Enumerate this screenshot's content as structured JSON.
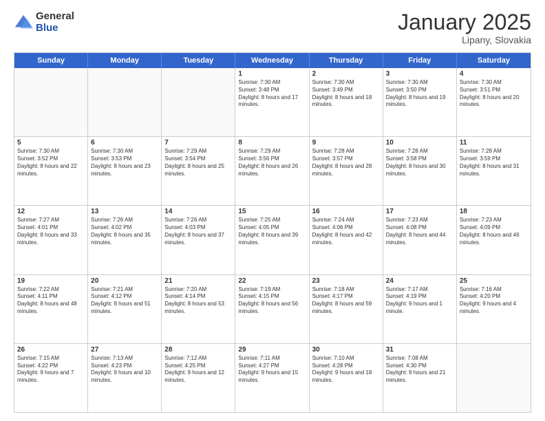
{
  "logo": {
    "general": "General",
    "blue": "Blue"
  },
  "title": "January 2025",
  "subtitle": "Lipany, Slovakia",
  "weekdays": [
    "Sunday",
    "Monday",
    "Tuesday",
    "Wednesday",
    "Thursday",
    "Friday",
    "Saturday"
  ],
  "weeks": [
    [
      {
        "day": "",
        "sunrise": "",
        "sunset": "",
        "daylight": ""
      },
      {
        "day": "",
        "sunrise": "",
        "sunset": "",
        "daylight": ""
      },
      {
        "day": "",
        "sunrise": "",
        "sunset": "",
        "daylight": ""
      },
      {
        "day": "1",
        "sunrise": "Sunrise: 7:30 AM",
        "sunset": "Sunset: 3:48 PM",
        "daylight": "Daylight: 8 hours and 17 minutes."
      },
      {
        "day": "2",
        "sunrise": "Sunrise: 7:30 AM",
        "sunset": "Sunset: 3:49 PM",
        "daylight": "Daylight: 8 hours and 18 minutes."
      },
      {
        "day": "3",
        "sunrise": "Sunrise: 7:30 AM",
        "sunset": "Sunset: 3:50 PM",
        "daylight": "Daylight: 8 hours and 19 minutes."
      },
      {
        "day": "4",
        "sunrise": "Sunrise: 7:30 AM",
        "sunset": "Sunset: 3:51 PM",
        "daylight": "Daylight: 8 hours and 20 minutes."
      }
    ],
    [
      {
        "day": "5",
        "sunrise": "Sunrise: 7:30 AM",
        "sunset": "Sunset: 3:52 PM",
        "daylight": "Daylight: 8 hours and 22 minutes."
      },
      {
        "day": "6",
        "sunrise": "Sunrise: 7:30 AM",
        "sunset": "Sunset: 3:53 PM",
        "daylight": "Daylight: 8 hours and 23 minutes."
      },
      {
        "day": "7",
        "sunrise": "Sunrise: 7:29 AM",
        "sunset": "Sunset: 3:54 PM",
        "daylight": "Daylight: 8 hours and 25 minutes."
      },
      {
        "day": "8",
        "sunrise": "Sunrise: 7:29 AM",
        "sunset": "Sunset: 3:56 PM",
        "daylight": "Daylight: 8 hours and 26 minutes."
      },
      {
        "day": "9",
        "sunrise": "Sunrise: 7:28 AM",
        "sunset": "Sunset: 3:57 PM",
        "daylight": "Daylight: 8 hours and 28 minutes."
      },
      {
        "day": "10",
        "sunrise": "Sunrise: 7:28 AM",
        "sunset": "Sunset: 3:58 PM",
        "daylight": "Daylight: 8 hours and 30 minutes."
      },
      {
        "day": "11",
        "sunrise": "Sunrise: 7:28 AM",
        "sunset": "Sunset: 3:59 PM",
        "daylight": "Daylight: 8 hours and 31 minutes."
      }
    ],
    [
      {
        "day": "12",
        "sunrise": "Sunrise: 7:27 AM",
        "sunset": "Sunset: 4:01 PM",
        "daylight": "Daylight: 8 hours and 33 minutes."
      },
      {
        "day": "13",
        "sunrise": "Sunrise: 7:26 AM",
        "sunset": "Sunset: 4:02 PM",
        "daylight": "Daylight: 8 hours and 35 minutes."
      },
      {
        "day": "14",
        "sunrise": "Sunrise: 7:26 AM",
        "sunset": "Sunset: 4:03 PM",
        "daylight": "Daylight: 8 hours and 37 minutes."
      },
      {
        "day": "15",
        "sunrise": "Sunrise: 7:25 AM",
        "sunset": "Sunset: 4:05 PM",
        "daylight": "Daylight: 8 hours and 39 minutes."
      },
      {
        "day": "16",
        "sunrise": "Sunrise: 7:24 AM",
        "sunset": "Sunset: 4:06 PM",
        "daylight": "Daylight: 8 hours and 42 minutes."
      },
      {
        "day": "17",
        "sunrise": "Sunrise: 7:23 AM",
        "sunset": "Sunset: 4:08 PM",
        "daylight": "Daylight: 8 hours and 44 minutes."
      },
      {
        "day": "18",
        "sunrise": "Sunrise: 7:23 AM",
        "sunset": "Sunset: 4:09 PM",
        "daylight": "Daylight: 8 hours and 46 minutes."
      }
    ],
    [
      {
        "day": "19",
        "sunrise": "Sunrise: 7:22 AM",
        "sunset": "Sunset: 4:11 PM",
        "daylight": "Daylight: 8 hours and 48 minutes."
      },
      {
        "day": "20",
        "sunrise": "Sunrise: 7:21 AM",
        "sunset": "Sunset: 4:12 PM",
        "daylight": "Daylight: 8 hours and 51 minutes."
      },
      {
        "day": "21",
        "sunrise": "Sunrise: 7:20 AM",
        "sunset": "Sunset: 4:14 PM",
        "daylight": "Daylight: 8 hours and 53 minutes."
      },
      {
        "day": "22",
        "sunrise": "Sunrise: 7:19 AM",
        "sunset": "Sunset: 4:15 PM",
        "daylight": "Daylight: 8 hours and 56 minutes."
      },
      {
        "day": "23",
        "sunrise": "Sunrise: 7:18 AM",
        "sunset": "Sunset: 4:17 PM",
        "daylight": "Daylight: 8 hours and 59 minutes."
      },
      {
        "day": "24",
        "sunrise": "Sunrise: 7:17 AM",
        "sunset": "Sunset: 4:19 PM",
        "daylight": "Daylight: 9 hours and 1 minute."
      },
      {
        "day": "25",
        "sunrise": "Sunrise: 7:16 AM",
        "sunset": "Sunset: 4:20 PM",
        "daylight": "Daylight: 9 hours and 4 minutes."
      }
    ],
    [
      {
        "day": "26",
        "sunrise": "Sunrise: 7:15 AM",
        "sunset": "Sunset: 4:22 PM",
        "daylight": "Daylight: 9 hours and 7 minutes."
      },
      {
        "day": "27",
        "sunrise": "Sunrise: 7:13 AM",
        "sunset": "Sunset: 4:23 PM",
        "daylight": "Daylight: 9 hours and 10 minutes."
      },
      {
        "day": "28",
        "sunrise": "Sunrise: 7:12 AM",
        "sunset": "Sunset: 4:25 PM",
        "daylight": "Daylight: 9 hours and 12 minutes."
      },
      {
        "day": "29",
        "sunrise": "Sunrise: 7:11 AM",
        "sunset": "Sunset: 4:27 PM",
        "daylight": "Daylight: 9 hours and 15 minutes."
      },
      {
        "day": "30",
        "sunrise": "Sunrise: 7:10 AM",
        "sunset": "Sunset: 4:28 PM",
        "daylight": "Daylight: 9 hours and 18 minutes."
      },
      {
        "day": "31",
        "sunrise": "Sunrise: 7:08 AM",
        "sunset": "Sunset: 4:30 PM",
        "daylight": "Daylight: 9 hours and 21 minutes."
      },
      {
        "day": "",
        "sunrise": "",
        "sunset": "",
        "daylight": ""
      }
    ]
  ]
}
